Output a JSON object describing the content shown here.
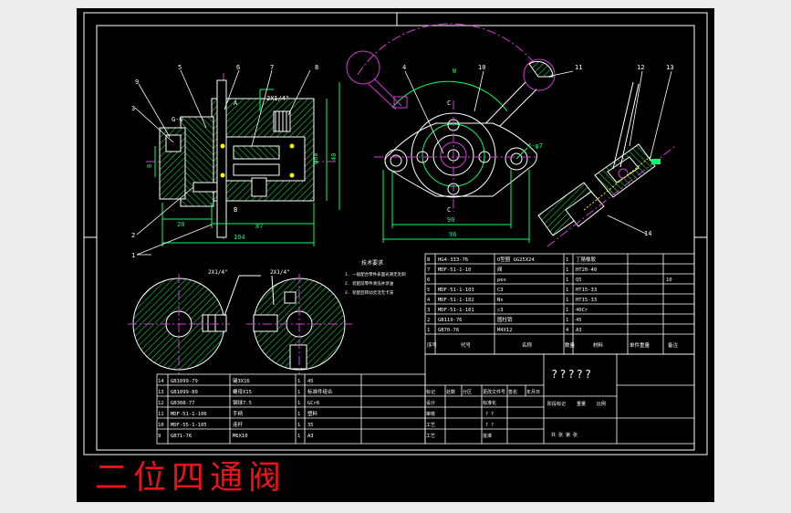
{
  "drawing_title": "二位四通阀",
  "part_balloons": [
    "1",
    "2",
    "3",
    "4",
    "5",
    "6",
    "7",
    "8",
    "9",
    "10",
    "11",
    "12",
    "13",
    "14"
  ],
  "dimensions": {
    "d_ext": "φ60",
    "d_60": "60",
    "d_40": "40",
    "d_87": "87",
    "d_104": "104",
    "d_20": "20",
    "d_90": "90",
    "d_96": "96",
    "d_holes": "4-φ7",
    "thread": "2X1/4\"",
    "thread_top": "2X1/4\"",
    "oil_port": "G-G",
    "sec_c": "C",
    "sec_a": "A",
    "sec_b": "B",
    "angle_w": "W",
    "dim_8": "8",
    "dim_16": "16"
  },
  "notes": {
    "title": "技术要求",
    "lines": [
      "1. 一般配合零件表面光滑无毛刺",
      "2. 装配前零件清洗并涂油",
      "3. 装配后转动灵活无卡滞"
    ]
  },
  "bom_upper": [
    {
      "no": "8",
      "code": "HG4-333-76",
      "name": "O型圈 GG25X24",
      "qty": "1",
      "mat": "丁腈橡胶",
      "remark": ""
    },
    {
      "no": "7",
      "code": "MDF-51-1-10",
      "name": "阀",
      "qty": "1",
      "mat": "HT20-40",
      "remark": ""
    },
    {
      "no": "6",
      "code": "",
      "name": "pes",
      "qty": "1",
      "mat": "Q5",
      "remark": "10"
    },
    {
      "no": "5",
      "code": "MDF-51-1-103",
      "name": "C3",
      "qty": "1",
      "mat": "HT15-33",
      "remark": ""
    },
    {
      "no": "4",
      "code": "MDF-51-1-102",
      "name": "Ns",
      "qty": "1",
      "mat": "HT15-33",
      "remark": ""
    },
    {
      "no": "3",
      "code": "MDF-51-1-101",
      "name": "c3",
      "qty": "1",
      "mat": "40Cr",
      "remark": ""
    },
    {
      "no": "2",
      "code": "GB119-76",
      "name": "圆柱销",
      "qty": "1",
      "mat": "45",
      "remark": ""
    },
    {
      "no": "1",
      "code": "GB70-76",
      "name": "M4X12",
      "qty": "4",
      "mat": "A3",
      "remark": ""
    }
  ],
  "bom_upper_header": {
    "no": "序号",
    "code": "代号",
    "name": "名称",
    "qty": "数量",
    "mat": "材料",
    "weight": "单件重量",
    "remark": "备注"
  },
  "bom_lower": [
    {
      "no": "14",
      "code": "GB1099-79",
      "name": "键3X16",
      "qty": "1",
      "mat": "45"
    },
    {
      "no": "13",
      "code": "GB1099-80",
      "name": "螺母X15",
      "qty": "1",
      "mat": "标准件组合"
    },
    {
      "no": "12",
      "code": "GB308-77",
      "name": "钢球7.5",
      "qty": "1",
      "mat": "GCr6"
    },
    {
      "no": "11",
      "code": "MDF-51-1-106",
      "name": "手柄",
      "qty": "1",
      "mat": "塑料"
    },
    {
      "no": "10",
      "code": "MDF-55-1-105",
      "name": "连杆",
      "qty": "1",
      "mat": "35"
    },
    {
      "no": "9",
      "code": "GB71-76",
      "name": "M6X10",
      "qty": "1",
      "mat": "A3"
    }
  ],
  "title_block": {
    "drawing_name": "?????",
    "row_labels": [
      "标记",
      "处数",
      "分区",
      "更改文件号",
      "签名",
      "年月日"
    ],
    "design": "设计",
    "check": "审核",
    "process": "工艺",
    "standard": "标准化",
    "approve": "批准",
    "stage_labels": [
      "阶段标记",
      "重量",
      "比例"
    ],
    "sheet": "共 张 第 张",
    "qmarks": "? ?"
  },
  "colors": {
    "background": "#000000",
    "frame": "#ffffff",
    "part_line": "#ffffff",
    "hatch": "#00cc44",
    "center_line": "#d23cd2",
    "dimension": "#00ff66",
    "caption": "#e8141c",
    "page": "#ececec"
  }
}
